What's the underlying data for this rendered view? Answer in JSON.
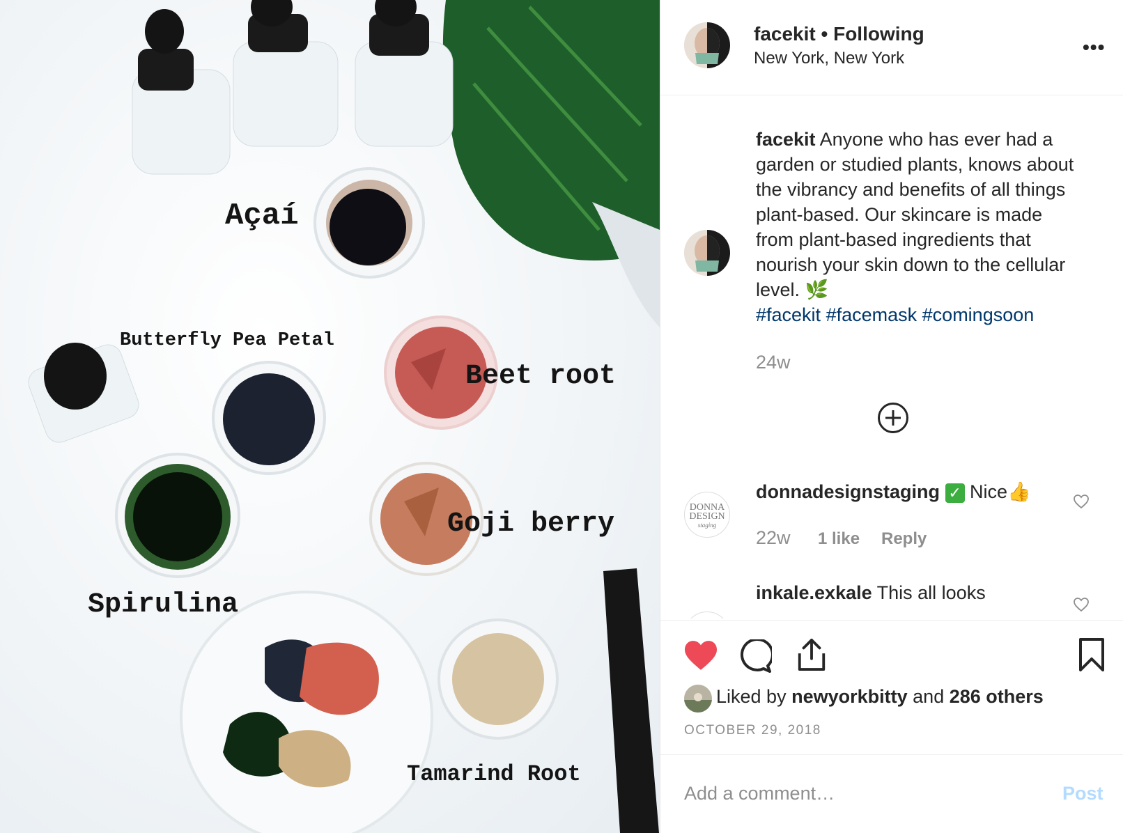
{
  "photo": {
    "labels": {
      "acai": "Açaí",
      "butterfly": "Butterfly Pea Petal",
      "beet": "Beet root",
      "goji": "Goji berry",
      "spirulina": "Spirulina",
      "tamarind": "Tamarind Root"
    }
  },
  "header": {
    "username": "facekit",
    "separator": "•",
    "follow_status": "Following",
    "location": "New York, New York",
    "more_label": "•••"
  },
  "caption": {
    "username": "facekit",
    "text": "Anyone who has ever had a garden or studied plants, knows about the vibrancy and benefits of all things plant-based. Our skincare is made from plant-based ingredients that nourish your skin down to the cellular level. 🌿",
    "hashtags": [
      "#facekit",
      "#facemask",
      "#comingsoon"
    ],
    "time": "24w"
  },
  "comments": [
    {
      "username": "donnadesignstaging",
      "text": "Nice👍",
      "time": "22w",
      "likes": "1 like",
      "reply": "Reply",
      "avatar_text": [
        "DONNA",
        "DESIGN",
        "staging"
      ]
    },
    {
      "username": "inkale.exkale",
      "text": "This all looks"
    }
  ],
  "actions": {
    "liked_prefix": "Liked by",
    "liked_user": "newyorkbitty",
    "liked_and": "and",
    "liked_others": "286 others",
    "date": "OCTOBER 29, 2018"
  },
  "comment_box": {
    "placeholder": "Add a comment…",
    "post_label": "Post"
  },
  "colors": {
    "like_red": "#ed4956",
    "hashtag": "#00376b",
    "post_disabled": "#b3dbff",
    "muted": "#8e8e8e"
  }
}
